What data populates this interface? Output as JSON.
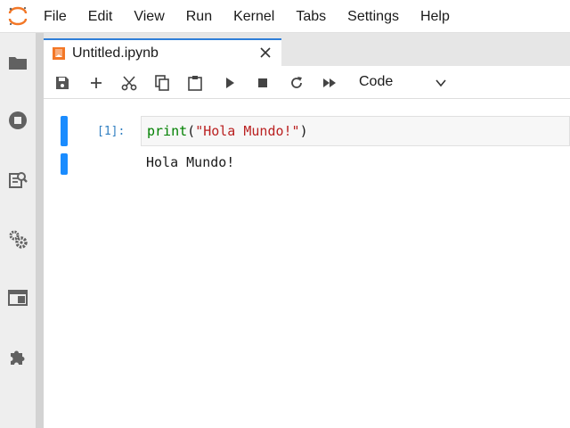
{
  "menu": [
    "File",
    "Edit",
    "View",
    "Run",
    "Kernel",
    "Tabs",
    "Settings",
    "Help"
  ],
  "tab": {
    "title": "Untitled.ipynb"
  },
  "toolbar": {
    "cell_type": "Code"
  },
  "cells": [
    {
      "prompt": "[1]:",
      "code": {
        "func": "print",
        "open": "(",
        "string": "\"Hola Mundo!\"",
        "close": ")"
      },
      "output": "Hola Mundo!"
    }
  ],
  "colors": {
    "accent": "#2f7ed8",
    "collapser": "#1a8cff",
    "logo": "#f37726"
  },
  "icons": {
    "leftbar": [
      "folder-icon",
      "stop-circle-icon",
      "property-inspector-icon",
      "extension-manager-gears-icon",
      "tabs-icon",
      "puzzle-icon"
    ],
    "toolbar": [
      "save-icon",
      "add-icon",
      "cut-icon",
      "copy-icon",
      "paste-icon",
      "run-icon",
      "stop-icon",
      "restart-icon",
      "fast-forward-icon"
    ]
  }
}
